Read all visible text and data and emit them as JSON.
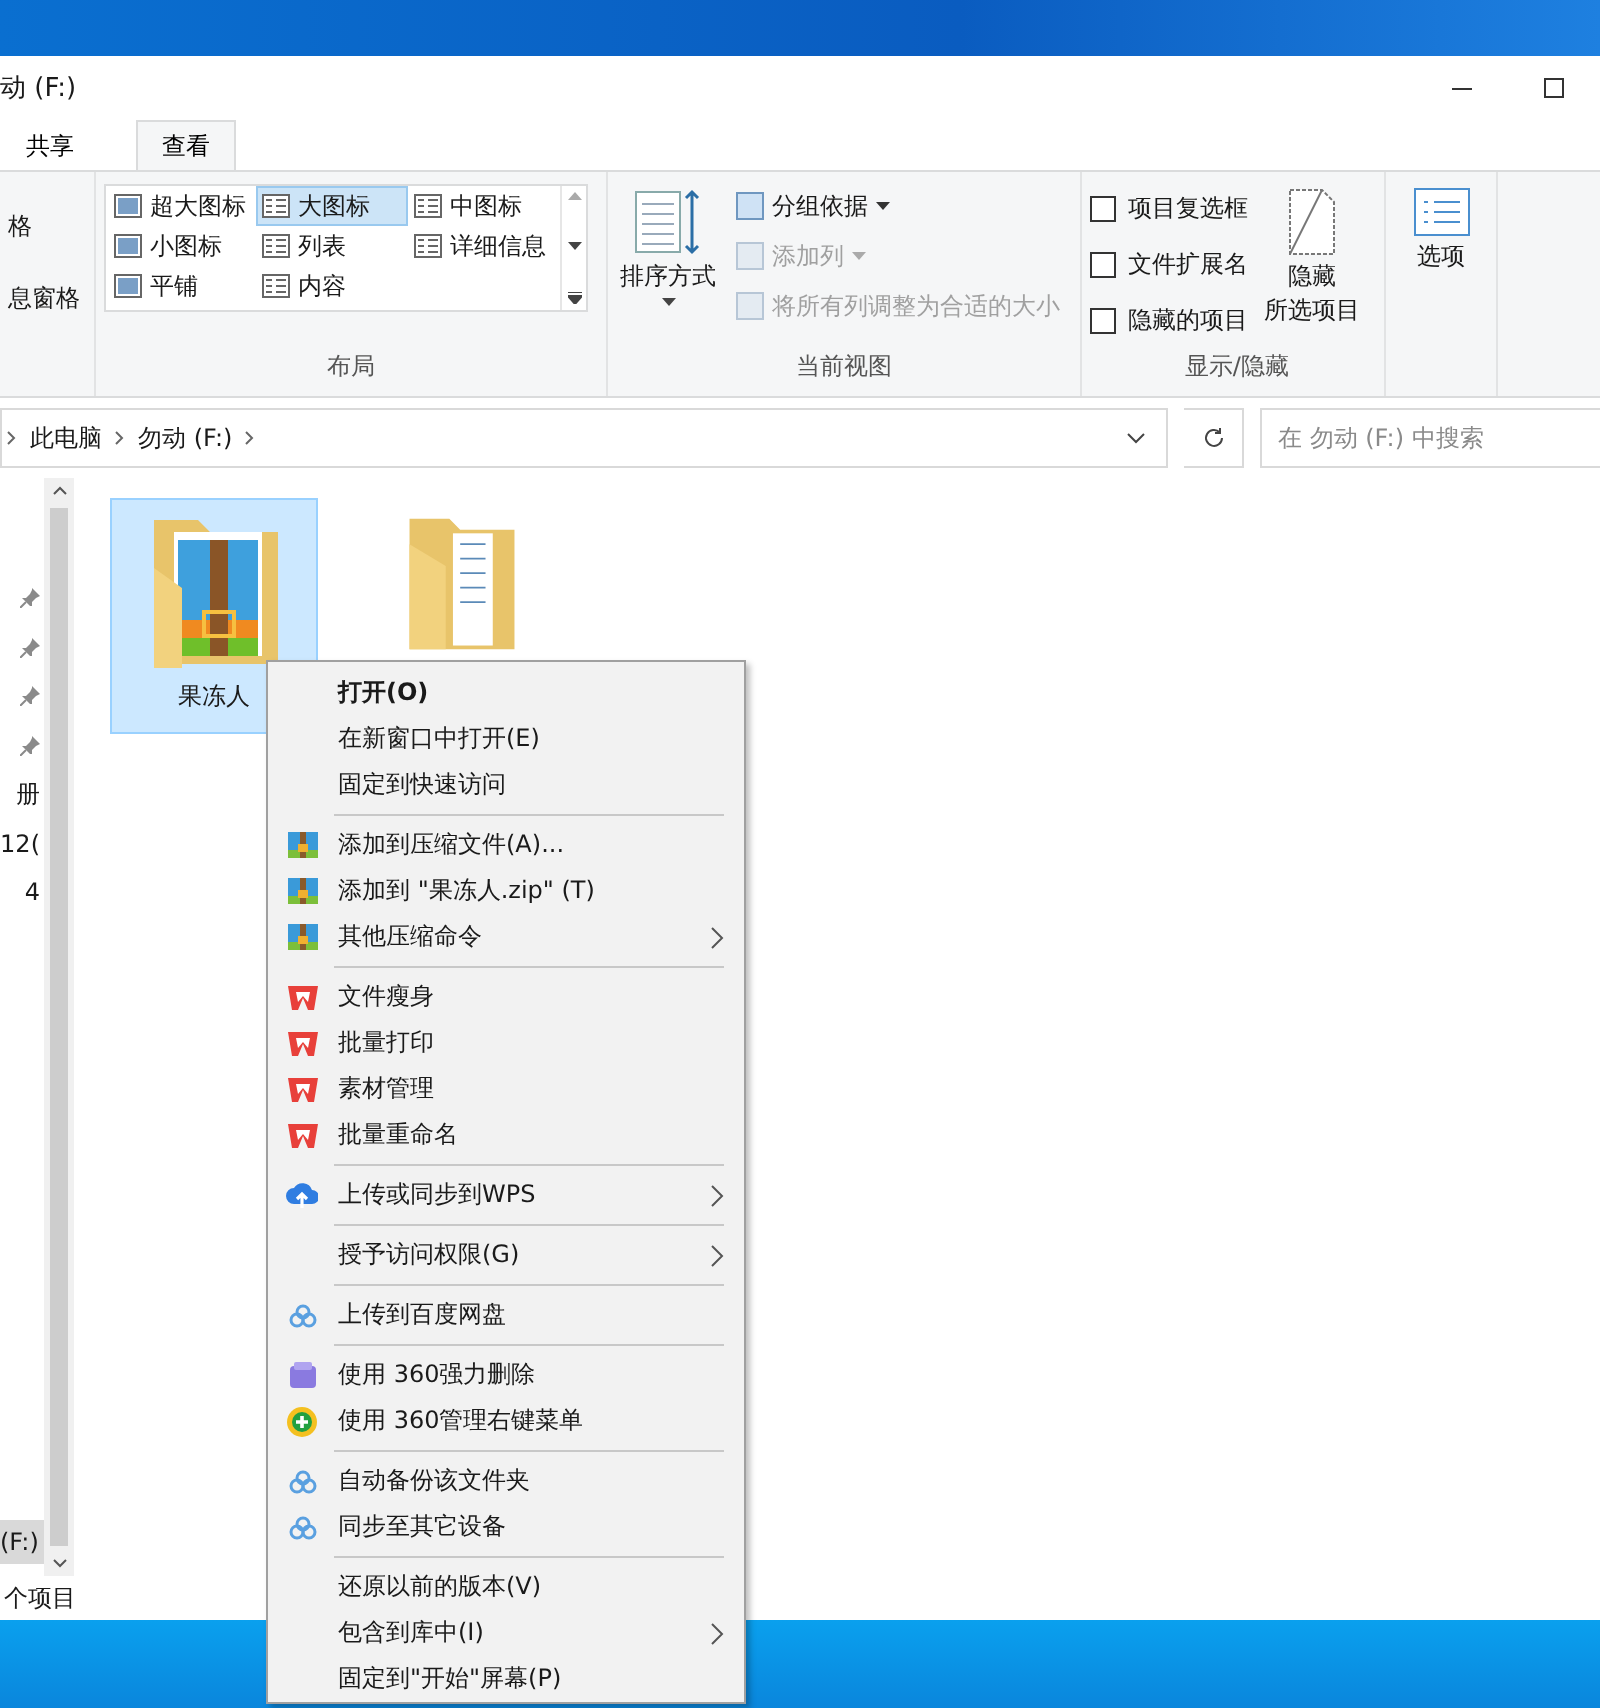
{
  "window": {
    "title": "动 (F:)"
  },
  "tabs": [
    {
      "label": "共享",
      "selected": false
    },
    {
      "label": "查看",
      "selected": true
    }
  ],
  "ribbon": {
    "pane_group": {
      "items": [
        "格",
        "息窗格"
      ]
    },
    "layout_group": {
      "label": "布局",
      "options": [
        {
          "label": "超大图标",
          "selected": false
        },
        {
          "label": "大图标",
          "selected": true
        },
        {
          "label": "中图标",
          "selected": false
        },
        {
          "label": "小图标",
          "selected": false
        },
        {
          "label": "列表",
          "selected": false
        },
        {
          "label": "详细信息",
          "selected": false
        },
        {
          "label": "平铺",
          "selected": false
        },
        {
          "label": "内容",
          "selected": false
        }
      ]
    },
    "view_group": {
      "label": "当前视图",
      "sort_button": "排序方式",
      "commands": [
        {
          "label": "分组依据",
          "disabled": false,
          "dropdown": true
        },
        {
          "label": "添加列",
          "disabled": true,
          "dropdown": true
        },
        {
          "label": "将所有列调整为合适的大小",
          "disabled": true,
          "dropdown": false
        }
      ]
    },
    "show_hide_group": {
      "label": "显示/隐藏",
      "checkboxes": [
        {
          "label": "项目复选框",
          "checked": false
        },
        {
          "label": "文件扩展名",
          "checked": false
        },
        {
          "label": "隐藏的项目",
          "checked": false
        }
      ],
      "hide_button": [
        "隐藏",
        "所选项目"
      ]
    },
    "options_button": "选项"
  },
  "address_bar": {
    "path": [
      "此电脑",
      "勿动 (F:)"
    ],
    "search_placeholder": "在 勿动 (F:) 中搜索"
  },
  "nav_pane": {
    "items": [
      {
        "kind": "pin"
      },
      {
        "kind": "pin"
      },
      {
        "kind": "pin"
      },
      {
        "kind": "pin"
      },
      {
        "kind": "text",
        "label": "册"
      },
      {
        "kind": "text",
        "label": "12("
      },
      {
        "kind": "text",
        "label": "4"
      }
    ],
    "drive": {
      "label": "(F:)",
      "selected": true
    }
  },
  "files": [
    {
      "name": "果冻人",
      "kind": "archive",
      "selected": true
    },
    {
      "kind": "folder",
      "selected": false
    }
  ],
  "status_bar": "个项目",
  "context_menu": [
    [
      {
        "label": "打开(O)",
        "kind": "plain",
        "default": true,
        "submenu": false
      },
      {
        "label": "在新窗口中打开(E)",
        "kind": "plain",
        "default": false,
        "submenu": false
      },
      {
        "label": "固定到快速访问",
        "kind": "plain",
        "default": false,
        "submenu": false
      }
    ],
    [
      {
        "label": "添加到压缩文件(A)...",
        "kind": "archive",
        "default": false,
        "submenu": false
      },
      {
        "label": "添加到 \"果冻人.zip\" (T)",
        "kind": "archive",
        "default": false,
        "submenu": false
      },
      {
        "label": "其他压缩命令",
        "kind": "archive",
        "default": false,
        "submenu": true
      }
    ],
    [
      {
        "label": "文件瘦身",
        "kind": "wps",
        "default": false,
        "submenu": false
      },
      {
        "label": "批量打印",
        "kind": "wps",
        "default": false,
        "submenu": false
      },
      {
        "label": "素材管理",
        "kind": "wps",
        "default": false,
        "submenu": false
      },
      {
        "label": "批量重命名",
        "kind": "wps",
        "default": false,
        "submenu": false
      }
    ],
    [
      {
        "label": "上传或同步到WPS",
        "kind": "upload",
        "default": false,
        "submenu": true
      }
    ],
    [
      {
        "label": "授予访问权限(G)",
        "kind": "plain",
        "default": false,
        "submenu": true
      }
    ],
    [
      {
        "label": "上传到百度网盘",
        "kind": "cloud",
        "default": false,
        "submenu": false
      }
    ],
    [
      {
        "label": "使用 360强力删除",
        "kind": "erase",
        "default": false,
        "submenu": false
      },
      {
        "label": "使用 360管理右键菜单",
        "kind": "shield",
        "default": false,
        "submenu": false
      }
    ],
    [
      {
        "label": "自动备份该文件夹",
        "kind": "cloud",
        "default": false,
        "submenu": false
      },
      {
        "label": "同步至其它设备",
        "kind": "cloud",
        "default": false,
        "submenu": false
      }
    ],
    [
      {
        "label": "还原以前的版本(V)",
        "kind": "plain",
        "default": false,
        "submenu": false
      },
      {
        "label": "包含到库中(I)",
        "kind": "plain",
        "default": false,
        "submenu": true
      },
      {
        "label": "固定到\"开始\"屏幕(P)",
        "kind": "plain",
        "default": false,
        "submenu": false
      }
    ]
  ]
}
